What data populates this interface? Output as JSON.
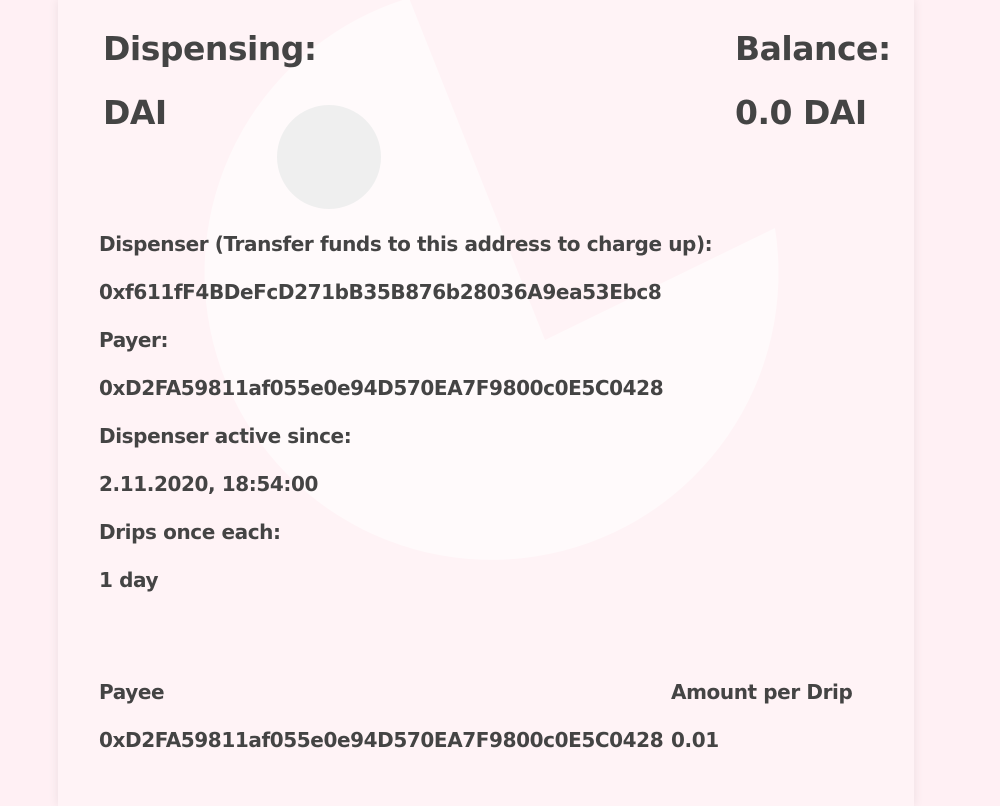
{
  "header": {
    "dispensing_label": "Dispensing:",
    "dispensing_value": "DAI",
    "balance_label": "Balance:",
    "balance_value": "0.0 DAI"
  },
  "details": {
    "dispenser_label": "Dispenser (Transfer funds to this address to charge up):",
    "dispenser_address": "0xf611fF4BDeFcD271bB35B876b28036A9ea53Ebc8",
    "payer_label": "Payer:",
    "payer_address": "0xD2FA59811af055e0e94D570EA7F9800c0E5C0428",
    "active_since_label": "Dispenser active since:",
    "active_since_value": "2.11.2020, 18:54:00",
    "drips_label": "Drips once each:",
    "drips_value": "1 day"
  },
  "payees_table": {
    "headers": {
      "payee": "Payee",
      "amount": "Amount per Drip"
    },
    "rows": [
      {
        "payee": "0xD2FA59811af055e0e94D570EA7F9800c0E5C0428",
        "amount": "0.01"
      }
    ]
  },
  "colors": {
    "page_background": "#fff0f4",
    "card_background": "#fff3f6",
    "text": "#444444",
    "decor_light": "#fffafb",
    "decor_circle": "#efefef"
  }
}
